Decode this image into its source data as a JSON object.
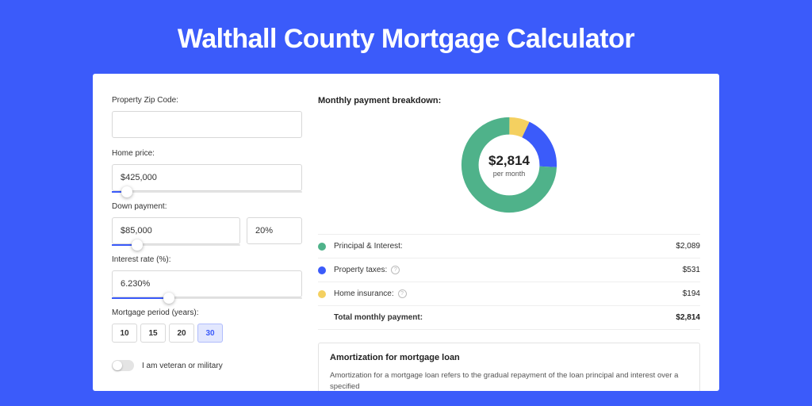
{
  "page_title": "Walthall County Mortgage Calculator",
  "colors": {
    "principal": "#4FB28A",
    "taxes": "#3B5BFA",
    "insurance": "#F4D060"
  },
  "form": {
    "zip_label": "Property Zip Code:",
    "zip_value": "",
    "home_price_label": "Home price:",
    "home_price_value": "$425,000",
    "home_price_slider_pct": 8,
    "down_payment_label": "Down payment:",
    "down_payment_value": "$85,000",
    "down_payment_pct_value": "20%",
    "down_payment_slider_pct": 20,
    "interest_label": "Interest rate (%):",
    "interest_value": "6.230%",
    "interest_slider_pct": 30,
    "period_label": "Mortgage period (years):",
    "periods": [
      "10",
      "15",
      "20",
      "30"
    ],
    "period_selected": "30",
    "veteran_label": "I am veteran or military"
  },
  "breakdown": {
    "title": "Monthly payment breakdown:",
    "center_value": "$2,814",
    "center_sub": "per month",
    "rows": [
      {
        "label": "Principal & Interest:",
        "value": "$2,089",
        "color_key": "principal",
        "info": false
      },
      {
        "label": "Property taxes:",
        "value": "$531",
        "color_key": "taxes",
        "info": true
      },
      {
        "label": "Home insurance:",
        "value": "$194",
        "color_key": "insurance",
        "info": true
      }
    ],
    "total_label": "Total monthly payment:",
    "total_value": "$2,814"
  },
  "chart_data": {
    "type": "pie",
    "title": "Monthly payment breakdown",
    "series": [
      {
        "name": "Principal & Interest",
        "value": 2089
      },
      {
        "name": "Property taxes",
        "value": 531
      },
      {
        "name": "Home insurance",
        "value": 194
      }
    ],
    "total": 2814,
    "unit": "USD per month"
  },
  "amort": {
    "title": "Amortization for mortgage loan",
    "text": "Amortization for a mortgage loan refers to the gradual repayment of the loan principal and interest over a specified"
  }
}
